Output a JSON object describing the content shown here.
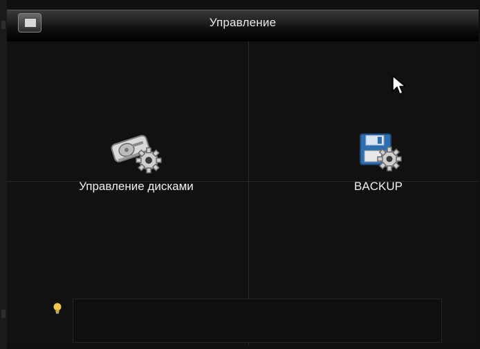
{
  "window": {
    "title": "Управление",
    "title_icon": "dvr-menu-icon"
  },
  "tiles": [
    {
      "label": "Управление дисками",
      "icon": "hdd-gear-icon"
    },
    {
      "label": "BACKUP",
      "icon": "backup-gear-icon"
    }
  ],
  "tip": {
    "icon": "lightbulb-icon",
    "text": ""
  },
  "colors": {
    "background": "#111111",
    "text": "#f2f2f2",
    "grid": "#2b2b2b",
    "bulb": "#f2c94c",
    "floppy": "#2f6fb0"
  }
}
